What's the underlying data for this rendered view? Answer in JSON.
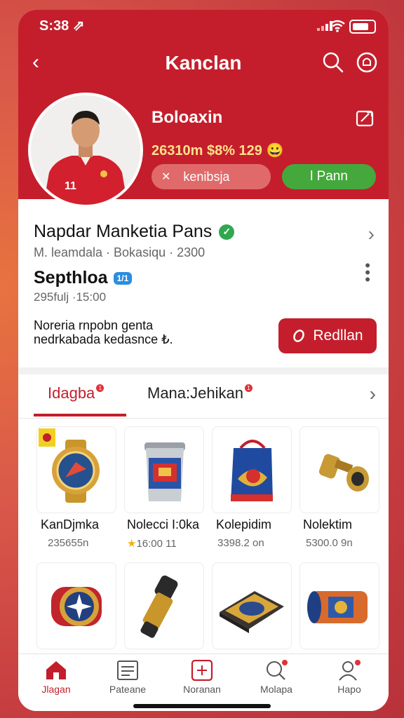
{
  "status": {
    "time": "S:38 ⇗"
  },
  "header": {
    "back": "‹",
    "title": "Kanclan"
  },
  "profile": {
    "name": "Boloaxin",
    "stats": "2​6310m $8% 12​9 😀",
    "follow_label": "kenibsja",
    "plan_label": "l Pann"
  },
  "info": {
    "title": "Napdar Manketia Pans",
    "subtitle": "M. leamdala · Bokasiqu · 2300",
    "section_title": "Septhloa",
    "section_badge": "1/1",
    "section_sub": "295fulj ·15:00",
    "description_line1": "Noreria rnpobn genta",
    "description_line2": "nedrkabada kedasnce ₺.",
    "action_label": "Redllan"
  },
  "tabs": [
    {
      "label": "Idagba",
      "badge": "1"
    },
    {
      "label": "Mana:Jehikan",
      "badge": "1"
    }
  ],
  "products": [
    {
      "name": "KanDjmka",
      "price": "2​356​55n"
    },
    {
      "name": "Nolecci I:0ka",
      "price": "16:00 11",
      "star": "★"
    },
    {
      "name": "Kolepidim",
      "price": "3398.2 on"
    },
    {
      "name": "Nolektim",
      "price": "5300.0 9n"
    },
    {
      "name": "",
      "price": ""
    },
    {
      "name": "",
      "price": ""
    },
    {
      "name": "",
      "price": ""
    },
    {
      "name": "",
      "price": ""
    }
  ],
  "bottom_nav": [
    {
      "label": "Jlagan",
      "active": true
    },
    {
      "label": "Pateane"
    },
    {
      "label": "Noranan"
    },
    {
      "label": "Molapa"
    },
    {
      "label": "Hapo"
    }
  ],
  "colors": {
    "brand_red": "#c41e2c",
    "green": "#44a83c",
    "accent_blue": "#2a8de0"
  }
}
